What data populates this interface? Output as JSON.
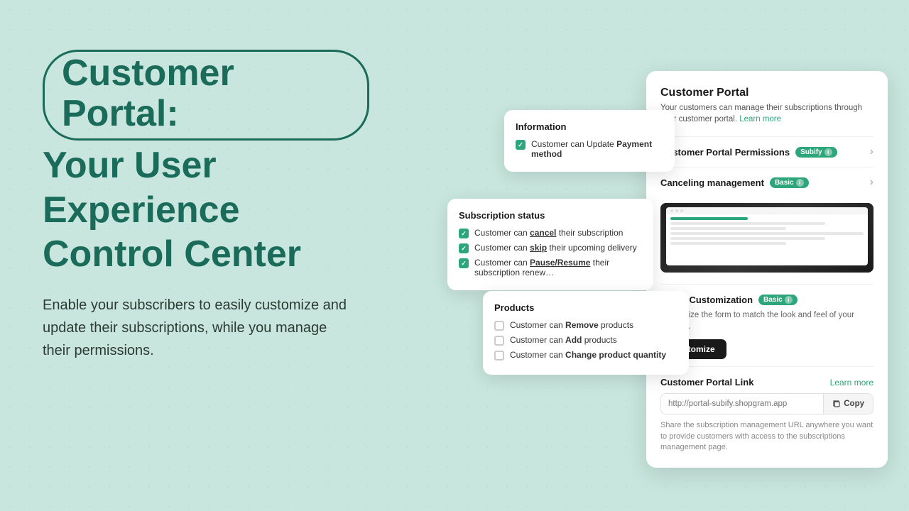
{
  "hero": {
    "title_line1": "Customer Portal:",
    "title_line2": "Your User Experience",
    "title_line3": "Control Center",
    "subtitle": "Enable your subscribers to easily customize and update their subscriptions, while you manage their permissions."
  },
  "portal_panel": {
    "title": "Customer Portal",
    "description": "Your customers can manage their subscriptions through your customer portal.",
    "learn_more": "Learn more",
    "rows": [
      {
        "label": "Customer Portal Permissions",
        "badge": "Subify",
        "has_chevron": true
      },
      {
        "label": "Canceling management",
        "badge": "Basic",
        "has_chevron": true
      }
    ],
    "customization": {
      "title": "Portal Customization",
      "badge": "Basic",
      "description": "Customize the form to match the look and feel of your website.",
      "button_label": "Customize"
    },
    "link_section": {
      "title": "Customer Portal Link",
      "learn_more": "Learn more",
      "url_placeholder": "http://portal-subify.shopgram.app",
      "copy_label": "Copy",
      "description": "Share the subscription management URL anywhere you want to provide customers with access to the subscriptions management page."
    }
  },
  "info_card": {
    "title": "Information",
    "items": [
      {
        "checked": true,
        "text_prefix": "Customer can Update ",
        "text_bold": "Payment method"
      }
    ]
  },
  "subscription_card": {
    "title": "Subscription status",
    "items": [
      {
        "checked": true,
        "text_prefix": "Customer can ",
        "text_underline": "cancel",
        "text_suffix": " their subscription"
      },
      {
        "checked": true,
        "text_prefix": "Customer can ",
        "text_underline": "skip",
        "text_suffix": " their upcoming delivery"
      },
      {
        "checked": true,
        "text_prefix": "Customer can ",
        "text_underline": "Pause/Resume",
        "text_suffix": " their subscription renew…"
      }
    ]
  },
  "products_card": {
    "title": "Products",
    "items": [
      {
        "checked": false,
        "text_prefix": "Customer can ",
        "text_bold": "Remove",
        "text_suffix": " products"
      },
      {
        "checked": false,
        "text_prefix": "Customer can ",
        "text_bold": "Add",
        "text_suffix": " products"
      },
      {
        "checked": false,
        "text_prefix": "Customer can ",
        "text_bold": "Change product quantity",
        "text_suffix": ""
      }
    ]
  }
}
